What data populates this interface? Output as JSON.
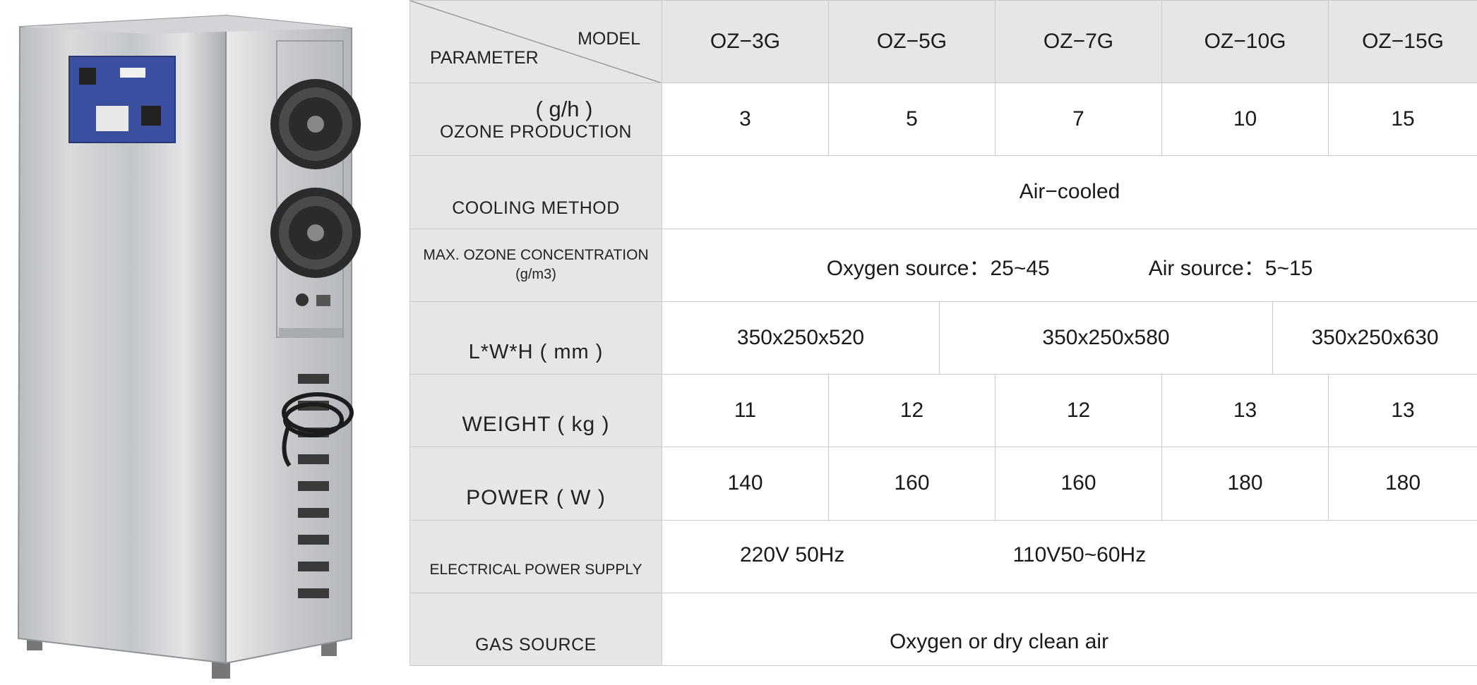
{
  "table": {
    "header": {
      "model_label": "MODEL",
      "parameter_label": "PARAMETER",
      "models": [
        "OZ−3G",
        "OZ−5G",
        "OZ−7G",
        "OZ−10G",
        "OZ−15G"
      ]
    },
    "ozone_production": {
      "unit": "( g/h )",
      "label": "OZONE PRODUCTION",
      "values": [
        "3",
        "5",
        "7",
        "10",
        "15"
      ]
    },
    "cooling": {
      "label": "COOLING METHOD",
      "value": "Air−cooled"
    },
    "concentration": {
      "label": "MAX. OZONE CONCENTRATION",
      "unit": "(g/m3)",
      "oxygen": "Oxygen source：25~45",
      "air": "Air source：5~15"
    },
    "dimensions": {
      "label": "L*W*H ( mm )",
      "values": [
        "350x250x520",
        "350x250x580",
        "350x250x630"
      ]
    },
    "weight": {
      "label": "WEIGHT ( kg )",
      "values": [
        "11",
        "12",
        "12",
        "13",
        "13"
      ]
    },
    "power": {
      "label": "POWER ( W )",
      "values": [
        "140",
        "160",
        "160",
        "180",
        "180"
      ]
    },
    "electrical": {
      "label": "ELECTRICAL POWER SUPPLY",
      "values": [
        "220V 50Hz",
        "110V50~60Hz"
      ]
    },
    "gas": {
      "label": "GAS SOURCE",
      "value": "Oxygen or dry clean air"
    }
  }
}
